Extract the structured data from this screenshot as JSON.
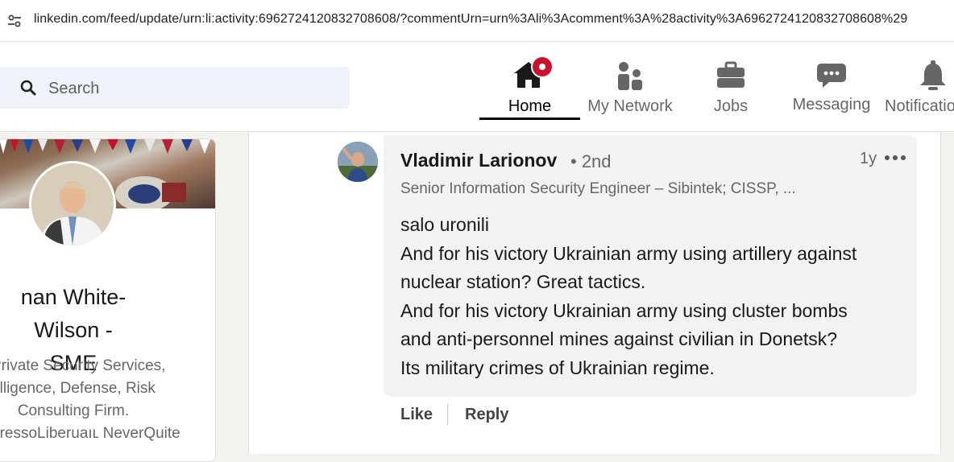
{
  "browser": {
    "url": "linkedin.com/feed/update/urn:li:activity:6962724120832708608/?commentUrn=urn%3Ali%3Acomment%3A%28activity%3A6962724120832708608%29"
  },
  "nav": {
    "search_placeholder": "Search",
    "items": [
      {
        "label": "Home",
        "icon": "home-icon",
        "active": true
      },
      {
        "label": "My Network",
        "icon": "people-icon",
        "active": false
      },
      {
        "label": "Jobs",
        "icon": "briefcase-icon",
        "active": false
      },
      {
        "label": "Messaging",
        "icon": "chat-icon",
        "active": false
      },
      {
        "label": "Notifications",
        "icon": "bell-icon",
        "active": false
      }
    ],
    "accent_color": "#cb112d"
  },
  "profile": {
    "name_lines": [
      "nan White-Wilson -",
      "SME"
    ],
    "headline_lines": [
      "Private Security Services,",
      "elligence, Defense, Risk",
      "Consulting Firm.",
      "oressoLiberuaıʟ NeverQuite"
    ]
  },
  "comment": {
    "author": "Vladimir Larionov",
    "degree": "• 2nd",
    "time": "1y",
    "headline": "Senior Information Security Engineer – Sibintek; CISSP, ...",
    "body_lines": [
      "salo uronili",
      "And for his victory Ukrainian army using artillery against",
      "nuclear station? Great tactics.",
      "And for his victory Ukrainian army using cluster bombs",
      "and anti-personnel mines against civilian in Donetsk?",
      "Its military crimes of Ukrainian regime."
    ],
    "actions": {
      "like": "Like",
      "reply": "Reply"
    }
  }
}
